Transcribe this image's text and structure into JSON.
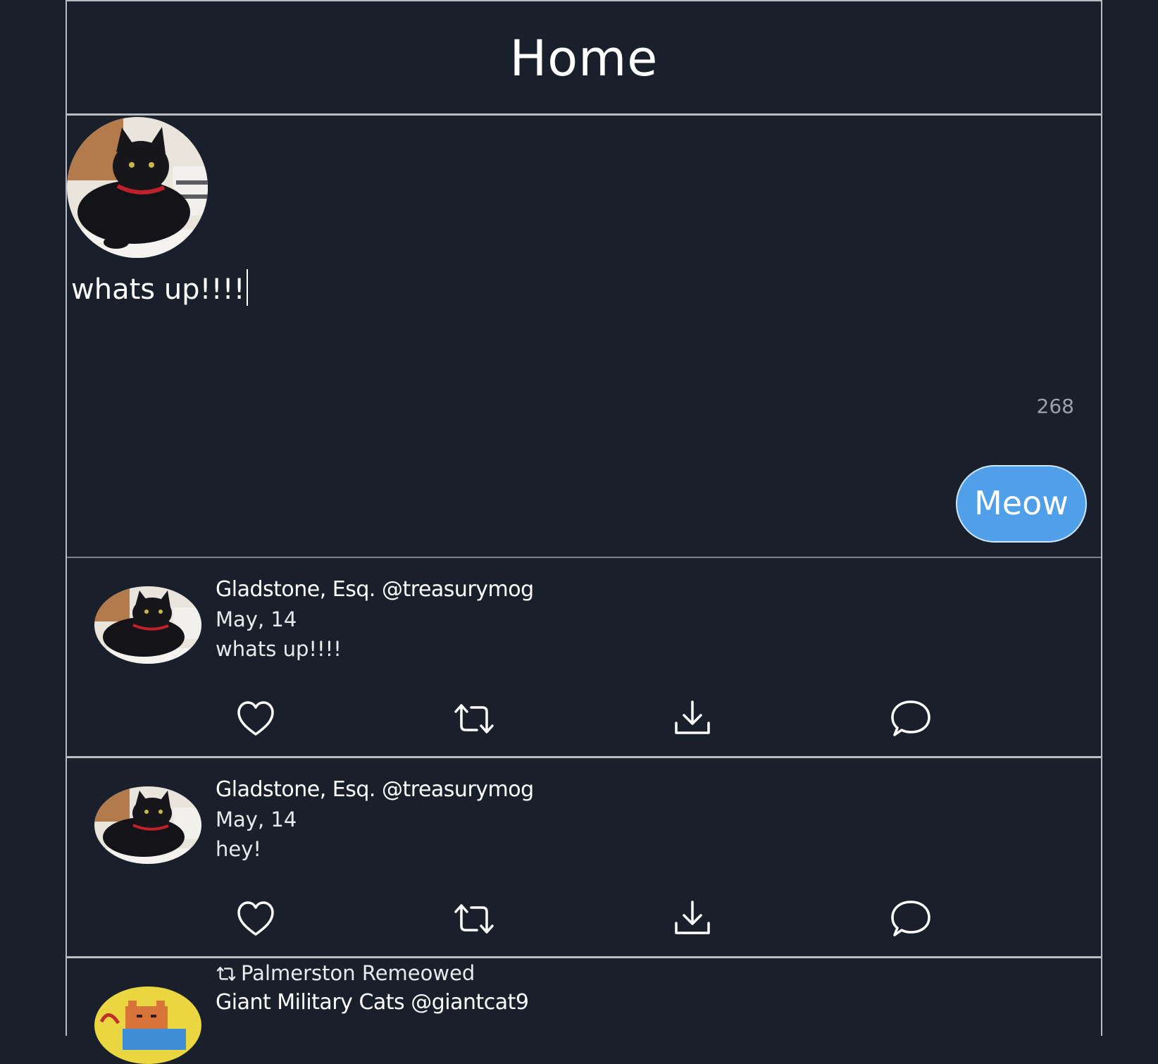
{
  "header": {
    "title": "Home"
  },
  "compose": {
    "text": "whats up!!!!",
    "char_remaining": "268",
    "submit_label": "Meow"
  },
  "posts": [
    {
      "display_name": "Gladstone, Esq.",
      "handle": "@treasurymog",
      "date": "May, 14",
      "body": "whats up!!!!",
      "avatar_icon": "black-cat-avatar"
    },
    {
      "display_name": "Gladstone, Esq.",
      "handle": "@treasurymog",
      "date": "May, 14",
      "body": "hey!",
      "avatar_icon": "black-cat-avatar"
    }
  ],
  "remeow_post": {
    "remeow_label": "Palmerston Remeowed",
    "display_name": "Giant Military Cats",
    "handle": "@giantcat9",
    "avatar_icon": "pixel-cat-avatar"
  },
  "icons": [
    "heart-icon",
    "remeow-icon",
    "download-icon",
    "comment-icon"
  ],
  "colors": {
    "background": "#19202b",
    "accent": "#4f9fe9",
    "border": "#b9bcc2"
  }
}
